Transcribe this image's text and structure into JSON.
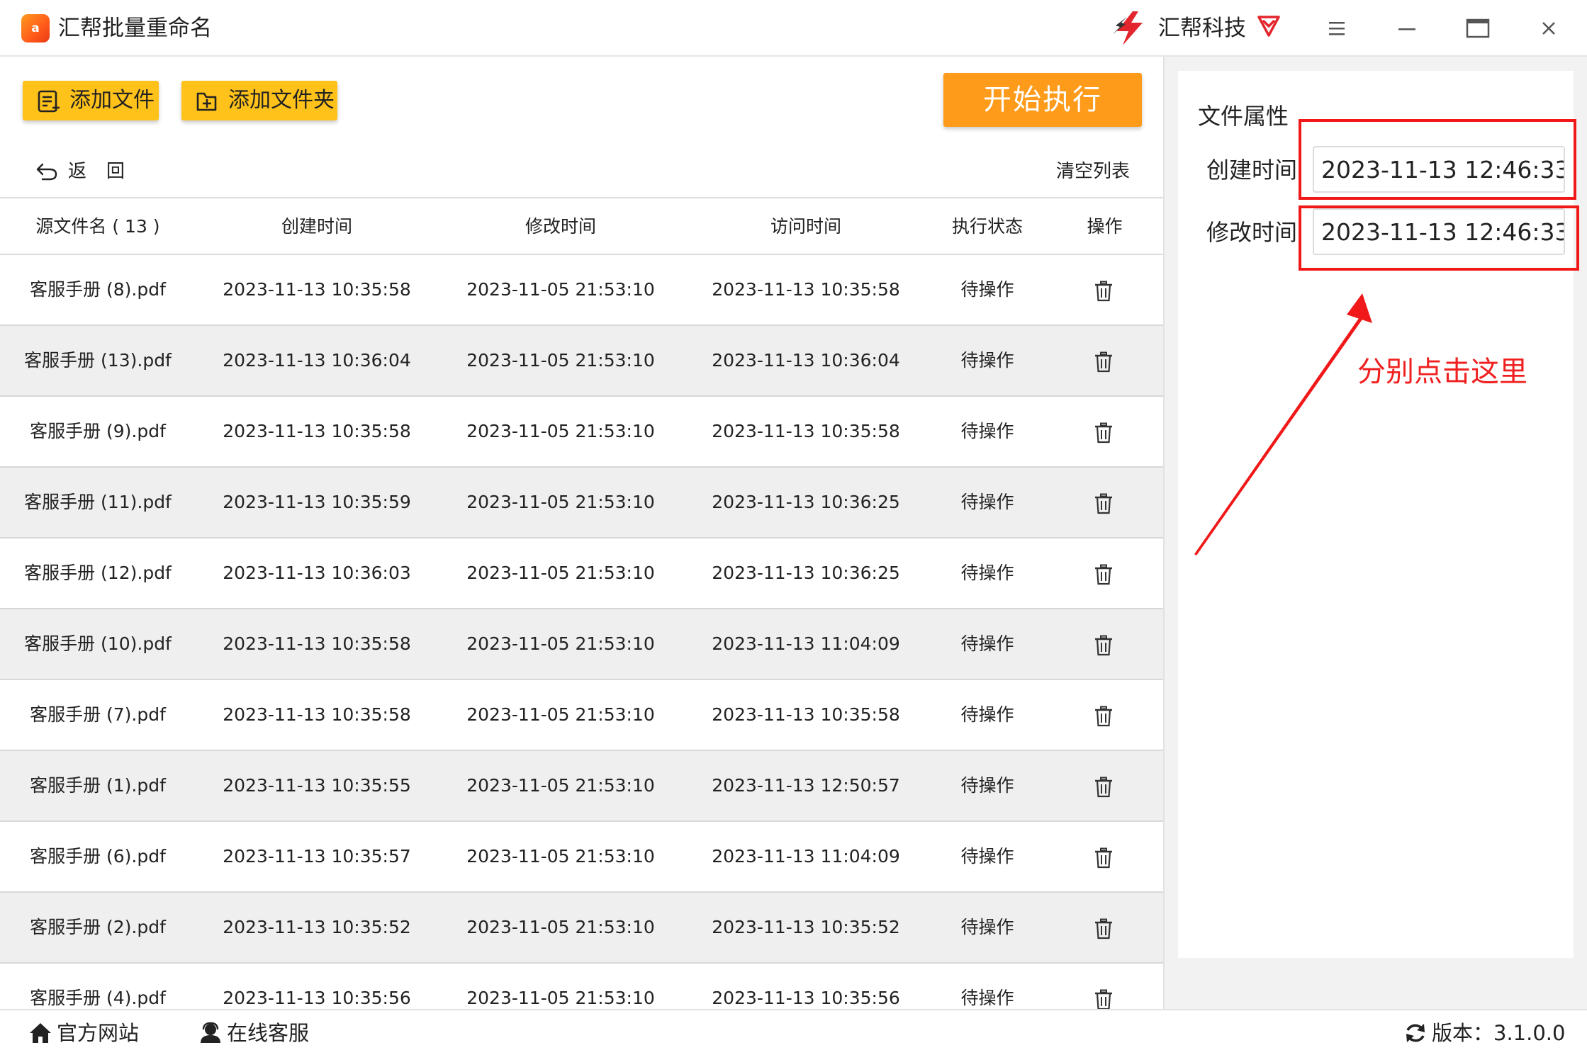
{
  "app": {
    "logo_text": "a",
    "title": "汇帮批量重命名",
    "brand": "汇帮科技"
  },
  "icons": {
    "app_logo": "app-logo-icon",
    "brand_logo": "lightning-bolt-icon",
    "vip": "diamond-heart-icon",
    "menu": "menu-icon",
    "minimize": "minimize-icon",
    "maximize": "maximize-icon",
    "close": "close-icon",
    "add_file": "add-file-icon",
    "add_folder": "add-folder-icon",
    "back": "back-arrow-icon",
    "delete": "trash-icon",
    "home": "home-icon",
    "service": "user-icon",
    "refresh": "refresh-icon"
  },
  "colors": {
    "yellow_button": "#ffc21a",
    "start_button": "#ff9b1a",
    "annotation_red": "#f01818"
  },
  "toolbar": {
    "add_file": "添加文件",
    "add_folder": "添加文件夹",
    "start": "开始执行",
    "back": "返回",
    "clear": "清空列表"
  },
  "table": {
    "headers": {
      "name": "源文件名 ( 13 )",
      "created": "创建时间",
      "modified": "修改时间",
      "accessed": "访问时间",
      "status": "执行状态",
      "action": "操作"
    },
    "rows": [
      {
        "name": "客服手册 (8).pdf",
        "created": "2023-11-13 10:35:58",
        "modified": "2023-11-05 21:53:10",
        "accessed": "2023-11-13 10:35:58",
        "status": "待操作"
      },
      {
        "name": "客服手册 (13).pdf",
        "created": "2023-11-13 10:36:04",
        "modified": "2023-11-05 21:53:10",
        "accessed": "2023-11-13 10:36:04",
        "status": "待操作"
      },
      {
        "name": "客服手册 (9).pdf",
        "created": "2023-11-13 10:35:58",
        "modified": "2023-11-05 21:53:10",
        "accessed": "2023-11-13 10:35:58",
        "status": "待操作"
      },
      {
        "name": "客服手册 (11).pdf",
        "created": "2023-11-13 10:35:59",
        "modified": "2023-11-05 21:53:10",
        "accessed": "2023-11-13 10:36:25",
        "status": "待操作"
      },
      {
        "name": "客服手册 (12).pdf",
        "created": "2023-11-13 10:36:03",
        "modified": "2023-11-05 21:53:10",
        "accessed": "2023-11-13 10:36:25",
        "status": "待操作"
      },
      {
        "name": "客服手册 (10).pdf",
        "created": "2023-11-13 10:35:58",
        "modified": "2023-11-05 21:53:10",
        "accessed": "2023-11-13 11:04:09",
        "status": "待操作"
      },
      {
        "name": "客服手册 (7).pdf",
        "created": "2023-11-13 10:35:58",
        "modified": "2023-11-05 21:53:10",
        "accessed": "2023-11-13 10:35:58",
        "status": "待操作"
      },
      {
        "name": "客服手册 (1).pdf",
        "created": "2023-11-13 10:35:55",
        "modified": "2023-11-05 21:53:10",
        "accessed": "2023-11-13 12:50:57",
        "status": "待操作"
      },
      {
        "name": "客服手册 (6).pdf",
        "created": "2023-11-13 10:35:57",
        "modified": "2023-11-05 21:53:10",
        "accessed": "2023-11-13 11:04:09",
        "status": "待操作"
      },
      {
        "name": "客服手册 (2).pdf",
        "created": "2023-11-13 10:35:52",
        "modified": "2023-11-05 21:53:10",
        "accessed": "2023-11-13 10:35:52",
        "status": "待操作"
      },
      {
        "name": "客服手册 (4).pdf",
        "created": "2023-11-13 10:35:56",
        "modified": "2023-11-05 21:53:10",
        "accessed": "2023-11-13 10:35:56",
        "status": "待操作"
      }
    ]
  },
  "panel": {
    "title": "文件属性",
    "created_label": "创建时间",
    "created_value": "2023-11-13 12:46:33",
    "modified_label": "修改时间",
    "modified_value": "2023-11-13 12:46:33",
    "annotation": "分别点击这里"
  },
  "status": {
    "website": "官方网站",
    "service": "在线客服",
    "version": "版本：3.1.0.0"
  }
}
